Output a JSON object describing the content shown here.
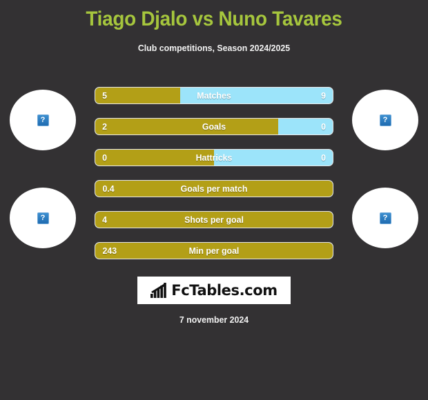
{
  "header": {
    "title": "Tiago Djalo vs Nuno Tavares",
    "subtitle": "Club competitions, Season 2024/2025",
    "title_color": "#a6c63d"
  },
  "colors": {
    "background": "#333133",
    "home_bar": "#b39f17",
    "away_bar": "#9ce4fa",
    "text": "#ffffff"
  },
  "avatars": [
    {
      "position": "left-top",
      "icon": "broken-image-icon",
      "glyph": "?"
    },
    {
      "position": "left-bottom",
      "icon": "broken-image-icon",
      "glyph": "?"
    },
    {
      "position": "right-top",
      "icon": "broken-image-icon",
      "glyph": "?"
    },
    {
      "position": "right-bottom",
      "icon": "broken-image-icon",
      "glyph": "?"
    }
  ],
  "chart_data": {
    "type": "bar",
    "title": "Tiago Djalo vs Nuno Tavares",
    "subtitle": "Club competitions, Season 2024/2025",
    "orientation": "horizontal-diverging",
    "series": [
      {
        "name": "Tiago Djalo",
        "color": "#b39f17",
        "values": [
          5,
          2,
          0,
          0.4,
          4,
          243
        ]
      },
      {
        "name": "Nuno Tavares",
        "color": "#9ce4fa",
        "values": [
          9,
          0,
          0,
          null,
          null,
          null
        ]
      }
    ],
    "categories": [
      "Matches",
      "Goals",
      "Hattricks",
      "Goals per match",
      "Shots per goal",
      "Min per goal"
    ],
    "rows": [
      {
        "label": "Matches",
        "home": "5",
        "away": "9",
        "home_pct": 35.7,
        "has_away": true
      },
      {
        "label": "Goals",
        "home": "2",
        "away": "0",
        "home_pct": 77.0,
        "has_away": true
      },
      {
        "label": "Hattricks",
        "home": "0",
        "away": "0",
        "home_pct": 50.0,
        "has_away": true
      },
      {
        "label": "Goals per match",
        "home": "0.4",
        "away": "",
        "home_pct": 100,
        "has_away": false
      },
      {
        "label": "Shots per goal",
        "home": "4",
        "away": "",
        "home_pct": 100,
        "has_away": false
      },
      {
        "label": "Min per goal",
        "home": "243",
        "away": "",
        "home_pct": 100,
        "has_away": false
      }
    ]
  },
  "footer": {
    "logo_text": "FcTables.com",
    "logo_icon": "bar-chart-arrow-icon",
    "date": "7 november 2024"
  }
}
